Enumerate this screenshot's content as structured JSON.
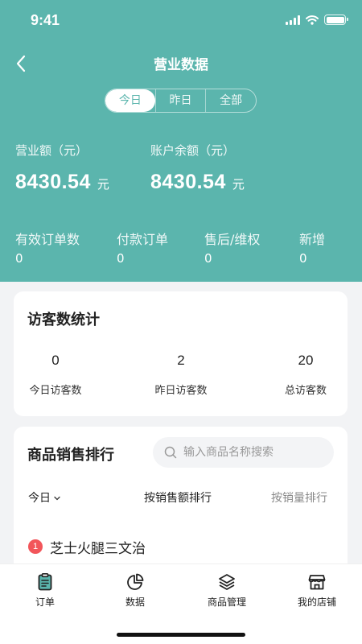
{
  "status_bar": {
    "time": "9:41"
  },
  "nav": {
    "title": "营业数据"
  },
  "segments": [
    {
      "label": "今日",
      "active": true
    },
    {
      "label": "昨日",
      "active": false
    },
    {
      "label": "全部",
      "active": false
    }
  ],
  "summary": {
    "revenue": {
      "label": "营业额（元）",
      "value": "8430.54",
      "unit": "元"
    },
    "balance": {
      "label": "账户余额（元）",
      "value": "8430.54",
      "unit": "元"
    }
  },
  "stats": [
    {
      "label": "有效订单数",
      "value": "0"
    },
    {
      "label": "付款订单",
      "value": "0"
    },
    {
      "label": "售后/维权",
      "value": "0"
    },
    {
      "label": "新增",
      "value": "0"
    }
  ],
  "visitors": {
    "title": "访客数统计",
    "items": [
      {
        "value": "0",
        "label": "今日访客数"
      },
      {
        "value": "2",
        "label": "昨日访客数"
      },
      {
        "value": "20",
        "label": "总访客数"
      }
    ]
  },
  "sales": {
    "title": "商品销售排行",
    "search_placeholder": "输入商品名称搜索",
    "period": "今日",
    "sort_by_amount": "按销售额排行",
    "sort_by_quantity": "按销量排行",
    "items": [
      {
        "rank": "1",
        "name": "芝士火腿三文治"
      }
    ]
  },
  "tabbar": [
    {
      "label": "订单",
      "icon": "clipboard-icon",
      "active": true
    },
    {
      "label": "数据",
      "icon": "pie-chart-icon",
      "active": false
    },
    {
      "label": "商品管理",
      "icon": "layers-icon",
      "active": false
    },
    {
      "label": "我的店铺",
      "icon": "store-icon",
      "active": false
    }
  ],
  "colors": {
    "primary": "#5bb5ad",
    "badge": "#f2555a"
  }
}
